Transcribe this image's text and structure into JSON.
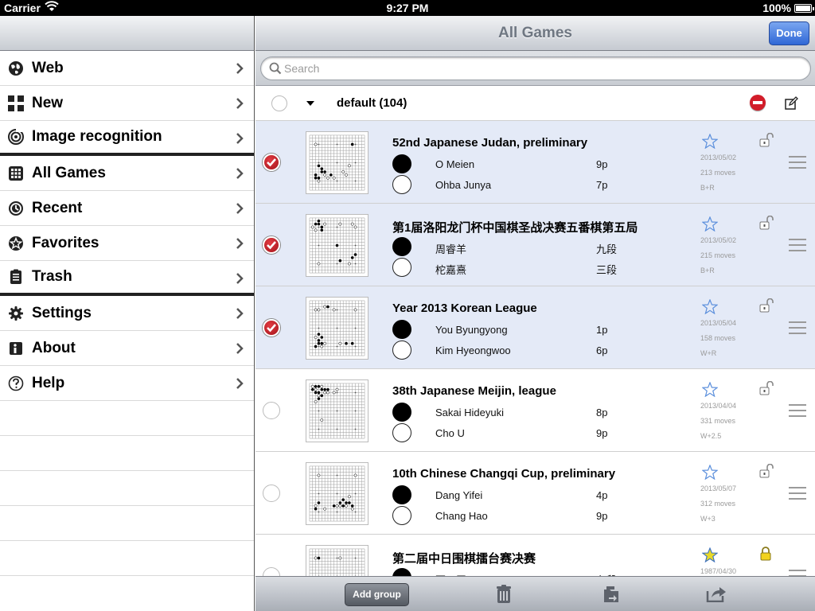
{
  "status": {
    "carrier": "Carrier",
    "time": "9:27 PM",
    "battery": "100%"
  },
  "sidebar": {
    "items": [
      {
        "label": "Web",
        "icon": "globe-icon"
      },
      {
        "label": "New",
        "icon": "plus-grid-icon"
      },
      {
        "label": "Image recognition",
        "icon": "camera-target-icon"
      },
      {
        "label": "All Games",
        "icon": "grid-icon"
      },
      {
        "label": "Recent",
        "icon": "clock-icon"
      },
      {
        "label": "Favorites",
        "icon": "star-badge-icon"
      },
      {
        "label": "Trash",
        "icon": "trash-icon"
      },
      {
        "label": "Settings",
        "icon": "gear-icon"
      },
      {
        "label": "About",
        "icon": "info-icon"
      },
      {
        "label": "Help",
        "icon": "question-icon"
      }
    ]
  },
  "nav": {
    "title": "All Games",
    "done": "Done"
  },
  "search": {
    "placeholder": "Search"
  },
  "group": {
    "name": "default (104)"
  },
  "games": [
    {
      "title": "52nd Japanese Judan, preliminary",
      "black": "O Meien",
      "black_rank": "9p",
      "white": "Ohba Junya",
      "white_rank": "7p",
      "date": "2013/05/02",
      "moves": "213 moves",
      "result": "B+R",
      "selected": true,
      "favorite": false,
      "locked": false
    },
    {
      "title": "第1届洛阳龙门杯中国棋圣战决赛五番棋第五局",
      "black": "周睿羊",
      "black_rank": "九段",
      "white": "柁嘉熹",
      "white_rank": "三段",
      "date": "2013/05/02",
      "moves": "215 moves",
      "result": "B+R",
      "selected": true,
      "favorite": false,
      "locked": false
    },
    {
      "title": "Year 2013 Korean League",
      "black": "You Byungyong",
      "black_rank": "1p",
      "white": "Kim Hyeongwoo",
      "white_rank": "6p",
      "date": "2013/05/04",
      "moves": "158 moves",
      "result": "W+R",
      "selected": true,
      "favorite": false,
      "locked": false
    },
    {
      "title": "38th Japanese Meijin, league",
      "black": "Sakai Hideyuki",
      "black_rank": "8p",
      "white": "Cho U",
      "white_rank": "9p",
      "date": "2013/04/04",
      "moves": "331 moves",
      "result": "W+2.5",
      "selected": false,
      "favorite": false,
      "locked": false
    },
    {
      "title": "10th Chinese Changqi Cup, preliminary",
      "black": "Dang Yifei",
      "black_rank": "4p",
      "white": "Chang Hao",
      "white_rank": "9p",
      "date": "2013/05/07",
      "moves": "312 moves",
      "result": "W+3",
      "selected": false,
      "favorite": false,
      "locked": false
    },
    {
      "title": "第二届中日围棋擂台赛决赛",
      "black": "聂卫平",
      "black_rank": "九段",
      "white": "",
      "white_rank": "",
      "date": "1987/04/30",
      "moves": "",
      "result": "",
      "selected": false,
      "favorite": true,
      "locked": true
    }
  ],
  "toolbar": {
    "add_group": "Add group"
  },
  "colors": {
    "accent": "#2f67d6",
    "selected_row": "#e4eaf7",
    "check": "#c41e25",
    "delete": "#d21d2a",
    "favorite": "#e8d92a",
    "lock": "#f2d21c"
  }
}
